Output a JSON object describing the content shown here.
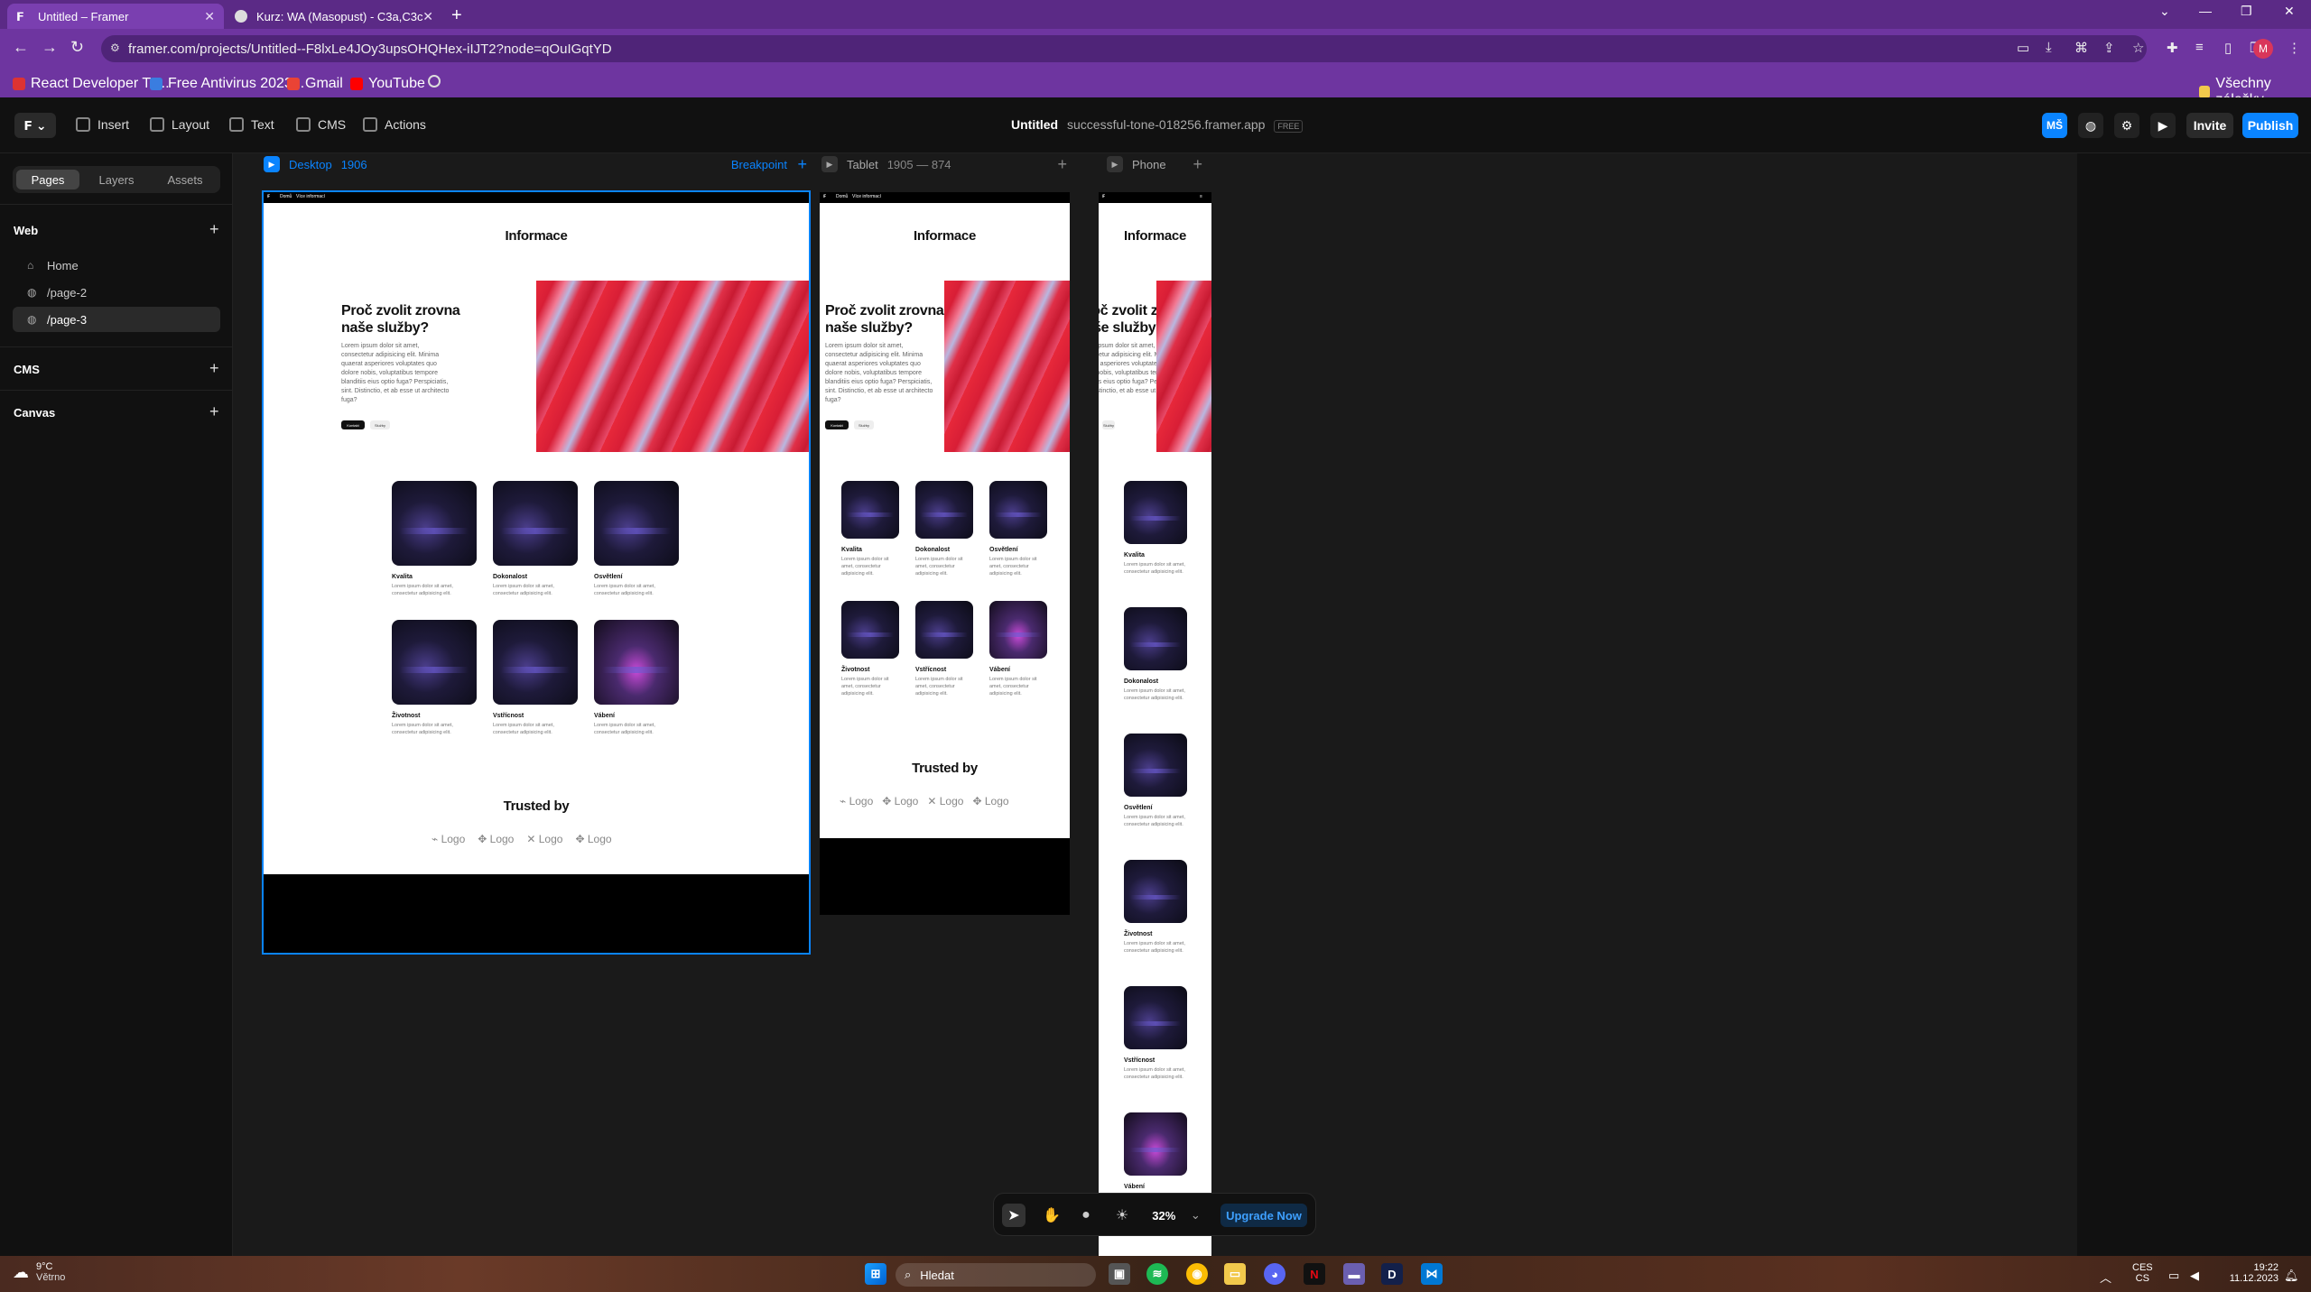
{
  "browser": {
    "tabs": [
      {
        "title": "Untitled – Framer",
        "active": true
      },
      {
        "title": "Kurz: WA (Masopust) - C3a,C3c",
        "active": false
      }
    ],
    "new_tab": "+",
    "window_controls": [
      "⌄",
      "—",
      "❐",
      "✕"
    ],
    "url": "framer.com/projects/Untitled--F8lxLe4JOy3upsOHQHex-iIJT2?node=qOuIGqtYD",
    "nav": [
      "←",
      "→",
      "↻"
    ],
    "bookmarks": [
      "React Developer To...",
      "Free Antivirus 2023...",
      "Gmail",
      "YouTube"
    ],
    "bookmarks_right": "Všechny záložky",
    "profile_letter": "M"
  },
  "framer": {
    "toolbar": {
      "insert": "Insert",
      "layout": "Layout",
      "text": "Text",
      "cms": "CMS",
      "actions": "Actions"
    },
    "project_name": "Untitled",
    "project_domain": "successful-tone-018256.framer.app",
    "plan_badge": "FREE",
    "avatar": "MŠ",
    "invite": "Invite",
    "publish": "Publish",
    "panel_tabs": [
      "Pages",
      "Layers",
      "Assets"
    ],
    "sections": {
      "web": "Web",
      "cms": "CMS",
      "canvas": "Canvas"
    },
    "pages": [
      "Home",
      "/page-2",
      "/page-3"
    ],
    "breakpoints": {
      "desktop": {
        "name": "Desktop",
        "size": "1906",
        "breakpoint": "Breakpoint"
      },
      "tablet": {
        "name": "Tablet",
        "size": "1905 — 874"
      },
      "phone": {
        "name": "Phone"
      }
    },
    "bottom_bar": {
      "zoom": "32%",
      "upgrade": "Upgrade Now"
    }
  },
  "site": {
    "nav_left": "Domů",
    "nav_right": "Více informací",
    "title": "Informace",
    "heading": "Proč zvolit zrovna naše služby?",
    "paragraph": "Lorem ipsum dolor sit amet, consectetur adipisicing elit. Minima quaerat asperiores voluptates quo dolore nobis, voluptatibus tempore blanditiis eius optio fuga? Perspiciatis, sint. Distinctio, et ab esse ut architecto fuga?",
    "btn_primary": "Kontakt",
    "btn_secondary": "Služby",
    "cards": [
      {
        "title": "Kvalita",
        "text": "Lorem ipsum dolor sit amet, consectetur adipisicing elit."
      },
      {
        "title": "Dokonalost",
        "text": "Lorem ipsum dolor sit amet, consectetur adipisicing elit."
      },
      {
        "title": "Osvětlení",
        "text": "Lorem ipsum dolor sit amet, consectetur adipisicing elit."
      },
      {
        "title": "Životnost",
        "text": "Lorem ipsum dolor sit amet, consectetur adipisicing elit."
      },
      {
        "title": "Vstřícnost",
        "text": "Lorem ipsum dolor sit amet, consectetur adipisicing elit."
      },
      {
        "title": "Vábení",
        "text": "Lorem ipsum dolor sit amet, consectetur adipisicing elit."
      }
    ],
    "trusted_by": "Trusted by",
    "logo_label": "Logo"
  },
  "taskbar": {
    "weather_temp": "9°C",
    "weather_desc": "Větrno",
    "search": "Hledat",
    "lang_top": "CES",
    "lang_bottom": "CS",
    "time": "19:22",
    "date": "11.12.2023"
  }
}
